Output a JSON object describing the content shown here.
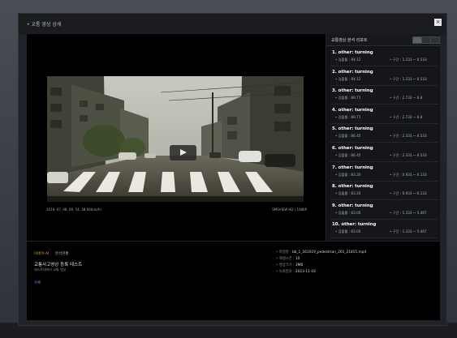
{
  "modal": {
    "title": "• 교통 영상 상세",
    "close_label": "×"
  },
  "video": {
    "timestamp": "2019. 07. 08. 09. 54. 38  60(km/h)",
    "resolution": "SMSVIEW HD | 1080P"
  },
  "results": {
    "title": "교통영상 분석 리포트",
    "items": [
      {
        "label": "1. other: turning",
        "score": "• 검출률 : 94.12",
        "range": "• 구간 : 1.333 ~ 6.533"
      },
      {
        "label": "2. other: turning",
        "score": "• 검출률 : 94.12",
        "range": "• 구간 : 1.333 ~ 6.533"
      },
      {
        "label": "3. other: turning",
        "score": "• 검출률 : 89.71",
        "range": "• 구간 : 2.733 ~ 6.8"
      },
      {
        "label": "4. other: turning",
        "score": "• 검출률 : 89.71",
        "range": "• 구간 : 2.733 ~ 6.8"
      },
      {
        "label": "5. other: turning",
        "score": "• 검출률 : 86.45",
        "range": "• 구간 : 2.333 ~ 6.533"
      },
      {
        "label": "6. other: turning",
        "score": "• 검출률 : 86.45",
        "range": "• 구간 : 2.333 ~ 6.533"
      },
      {
        "label": "7. other: turning",
        "score": "• 검출률 : 83.20",
        "range": "• 구간 : 0.933 ~ 6.133"
      },
      {
        "label": "8. other: turning",
        "score": "• 검출률 : 83.20",
        "range": "• 구간 : 0.933 ~ 6.133"
      },
      {
        "label": "9. other: turning",
        "score": "• 검출률 : 83.00",
        "range": "• 구간 : 1.333 ~ 5.467"
      },
      {
        "label": "10. other: turning",
        "score": "• 검출률 : 83.00",
        "range": "• 구간 : 1.333 ~ 5.467"
      }
    ]
  },
  "info": {
    "tab_active": "이네이-AI  ",
    "tab_other": "분석현황",
    "title": "교통사고영상 등록 테스트",
    "subtitle": "테스트데이터 교통 영상",
    "link": "목록",
    "meta": [
      {
        "key": "• 파일명 : ",
        "value": "bb_1_161019_pedestrian_201_21815.mp4"
      },
      {
        "key": "• 재생시간 : ",
        "value": "10"
      },
      {
        "key": "• 영상크기 : ",
        "value": "3MB"
      },
      {
        "key": "• 녹화일자 : ",
        "value": "2023-11-16"
      }
    ]
  }
}
